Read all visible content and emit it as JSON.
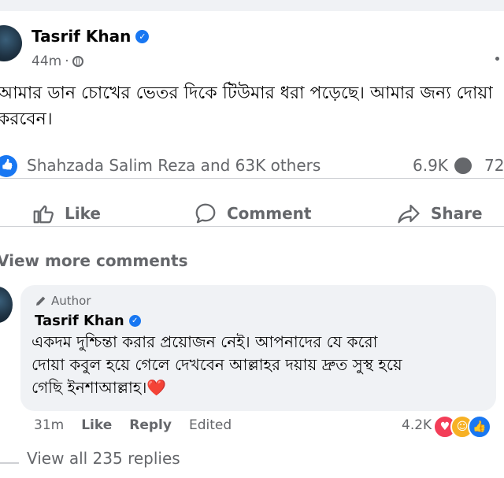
{
  "post": {
    "author": "Tasrif Khan",
    "time": "44m",
    "meta_separator": "·",
    "text": "আমার ডান চোখের ভেতর দিকে টিউমার ধরা পড়েছে। আমার জন্য দোয়া\nকরবেন।",
    "reactions_summary": "Shahzada Salim Reza and 63K others",
    "comment_count": "6.9K",
    "share_count": "72"
  },
  "actions": {
    "like": "Like",
    "comment": "Comment",
    "share": "Share"
  },
  "view_more_comments": "View more comments",
  "comment": {
    "author_tag": "Author",
    "author": "Tasrif Khan",
    "text": "একদম দুশ্চিন্তা করার প্রয়োজন নেই। আপনাদের যে করো\nদোয়া কবুল হয়ে গেলে দেখবেন আল্লাহর দয়ায় দ্রুত সুস্থ হয়ে\nগেছি ইনশাআল্লাহ।",
    "emoji": "❤️",
    "time": "31m",
    "like_label": "Like",
    "reply_label": "Reply",
    "edited_label": "Edited",
    "reaction_count": "4.2K",
    "reactions": [
      "love-icon",
      "care-icon",
      "like-icon"
    ]
  },
  "view_replies": "View all 235 replies",
  "colors": {
    "accent": "#1877f2",
    "secondary_text": "#65676b",
    "heart": "#e41e3f"
  }
}
